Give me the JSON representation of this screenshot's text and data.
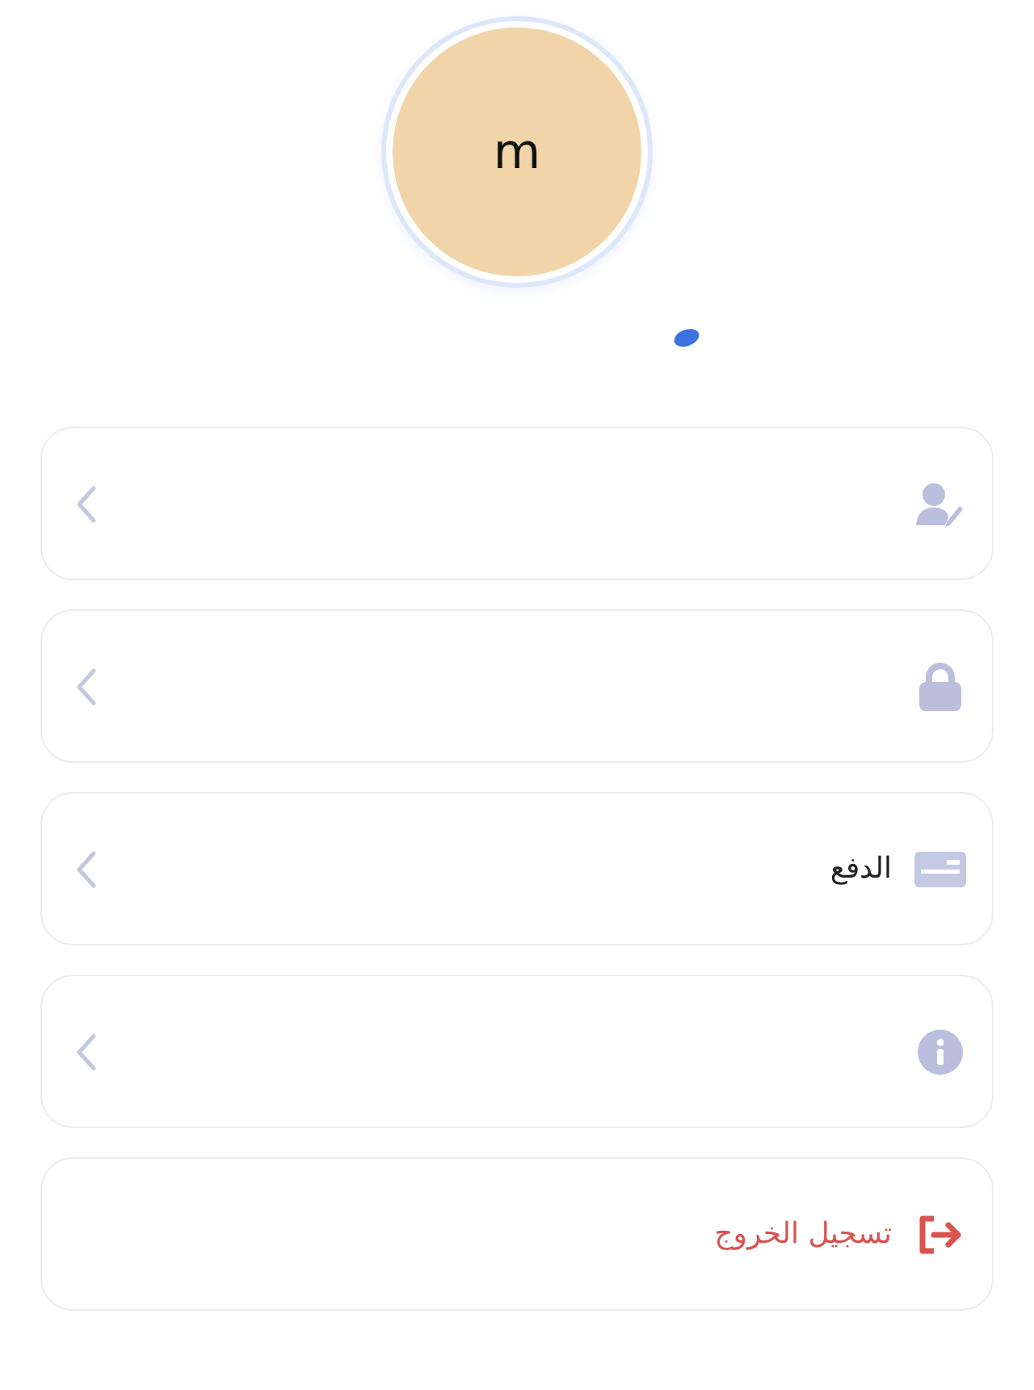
{
  "avatar": {
    "initial": "m"
  },
  "menu": [
    {
      "kind": "edit-profile"
    },
    {
      "kind": "password"
    },
    {
      "kind": "payment",
      "label": "الدفع"
    },
    {
      "kind": "about"
    },
    {
      "kind": "logout",
      "label": "تسجيل الخروج"
    }
  ]
}
